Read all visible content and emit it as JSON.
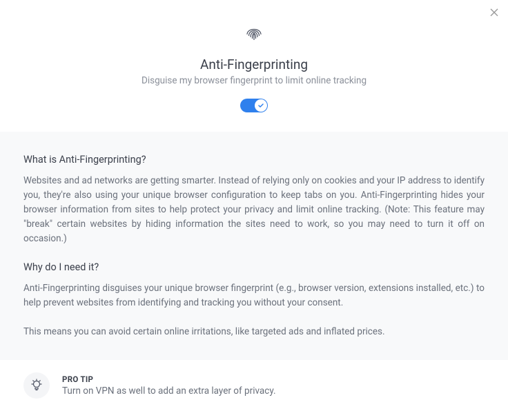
{
  "header": {
    "title": "Anti-Fingerprinting",
    "subtitle": "Disguise my browser fingerprint to limit online tracking",
    "toggle_on": true
  },
  "info": {
    "heading1": "What is Anti-Fingerprinting?",
    "text1": "Websites and ad networks are getting smarter. Instead of relying only on cookies and your IP address to identify you, they're also using your unique browser configuration to keep tabs on you. Anti-Fingerprinting hides your browser information from sites to help protect your privacy and limit online tracking. (Note: This feature may \"break\" certain websites by hiding information the sites need to work, so you may need to turn it off on occasion.)",
    "heading2": "Why do I need it?",
    "text2": "Anti-Fingerprinting disguises your unique browser fingerprint (e.g., browser version, extensions installed, etc.) to help prevent websites from identifying and tracking you without your consent.",
    "text3": "This means you can avoid certain online irritations, like targeted ads and inflated prices."
  },
  "tip": {
    "label": "PRO TIP",
    "text": "Turn on VPN as well to add an extra layer of privacy."
  }
}
